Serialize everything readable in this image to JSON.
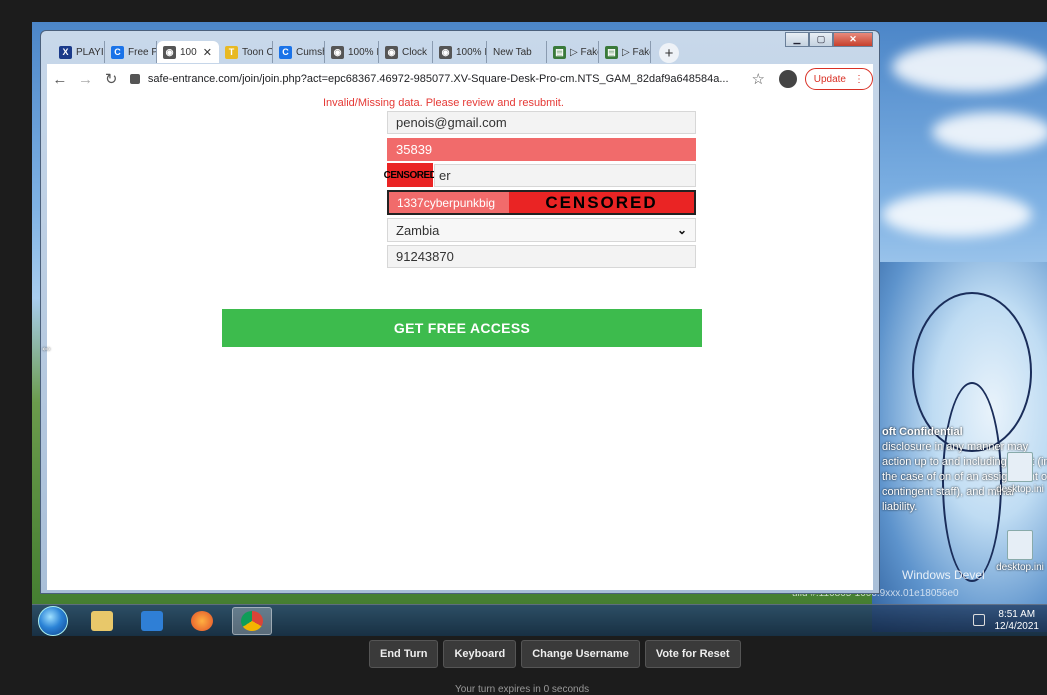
{
  "browser": {
    "tabs": [
      {
        "label": "PLAYII",
        "favicon": "x-icon",
        "color": "#1a3a8a",
        "glyph": "X"
      },
      {
        "label": "Free P",
        "favicon": "c-icon",
        "color": "#1a73e8",
        "glyph": "C"
      },
      {
        "label": "100",
        "favicon": "globe-icon",
        "color": "#555555",
        "glyph": "◉",
        "active": true
      },
      {
        "label": "Toon C",
        "favicon": "toon-icon",
        "color": "#e8b923",
        "glyph": "T"
      },
      {
        "label": "Cumsh",
        "favicon": "c-icon",
        "color": "#1a73e8",
        "glyph": "C"
      },
      {
        "label": "100% I",
        "favicon": "globe-icon",
        "color": "#555555",
        "glyph": "◉"
      },
      {
        "label": "Clock",
        "favicon": "globe-icon",
        "color": "#555555",
        "glyph": "◉"
      },
      {
        "label": "100% I",
        "favicon": "globe-icon",
        "color": "#555555",
        "glyph": "◉"
      },
      {
        "label": "New Tab",
        "favicon": "",
        "color": "",
        "glyph": ""
      },
      {
        "label": "▷ Fake",
        "favicon": "film-icon",
        "color": "#3a7a3a",
        "glyph": "▤"
      },
      {
        "label": "▷ Fake",
        "favicon": "film-icon",
        "color": "#3a7a3a",
        "glyph": "▤"
      }
    ],
    "url": "safe-entrance.com/join/join.php?act=epc68367.46972-985077.XV-Square-Desk-Pro-cm.NTS_GAM_82daf9a648584a...",
    "update_label": "Update"
  },
  "form": {
    "error_message": "Invalid/Missing data. Please review and resubmit.",
    "email": "penois@gmail.com",
    "zip": "35839",
    "name_censor_label": "CENSORED",
    "name_visible": "er",
    "password_visible": "1337cyberpunkbig",
    "password_censor_label": "CENSORED",
    "country": "Zambia",
    "phone": "91243870",
    "submit_label": "GET FREE ACCESS"
  },
  "desktop": {
    "confidential_title": "oft Confidential",
    "confidential_body": "disclosure in any manner may action up to and including ment (in the case of on of an assignment or contingent staff), and minal liability.",
    "icons": [
      "desktop.ini",
      "desktop.ini"
    ],
    "watermark": "Windows Devel",
    "watermark2": "uild #.110805-1000.9xxx.01e18056e0"
  },
  "taskbar": {
    "time": "8:51 AM",
    "date": "12/4/2021"
  },
  "controls": {
    "end_turn": "End Turn",
    "keyboard": "Keyboard",
    "change_username": "Change Username",
    "vote_reset": "Vote for Reset"
  },
  "footer_note": "Your turn expires in 0 seconds"
}
